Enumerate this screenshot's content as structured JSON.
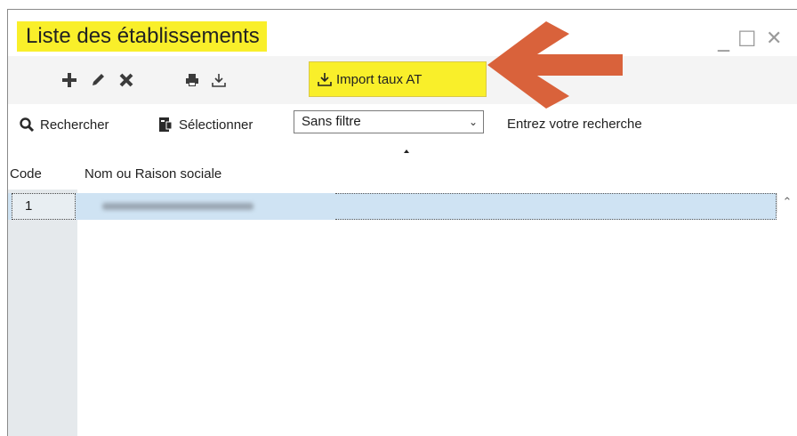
{
  "window": {
    "title": "Liste des établissements",
    "controls": {
      "minimize": "_",
      "maximize": "☐",
      "close": "✕"
    }
  },
  "toolbar": {
    "add_icon": "plus-icon",
    "edit_icon": "pencil-icon",
    "delete_icon": "x-icon",
    "print_icon": "printer-icon",
    "import_icon": "import-tray-icon",
    "import_label": "Import taux AT"
  },
  "searchbar": {
    "search_label": "Rechercher",
    "select_label": "Sélectionner",
    "filter_value": "Sans filtre",
    "search_placeholder": "Entrez votre recherche"
  },
  "grid": {
    "columns": [
      "Code",
      "Nom ou Raison sociale"
    ],
    "rows": [
      {
        "code": "1",
        "name": ""
      }
    ]
  },
  "colors": {
    "highlight": "#f9ef2a",
    "arrow": "#d9623b",
    "selected_row": "#cfe3f3"
  }
}
